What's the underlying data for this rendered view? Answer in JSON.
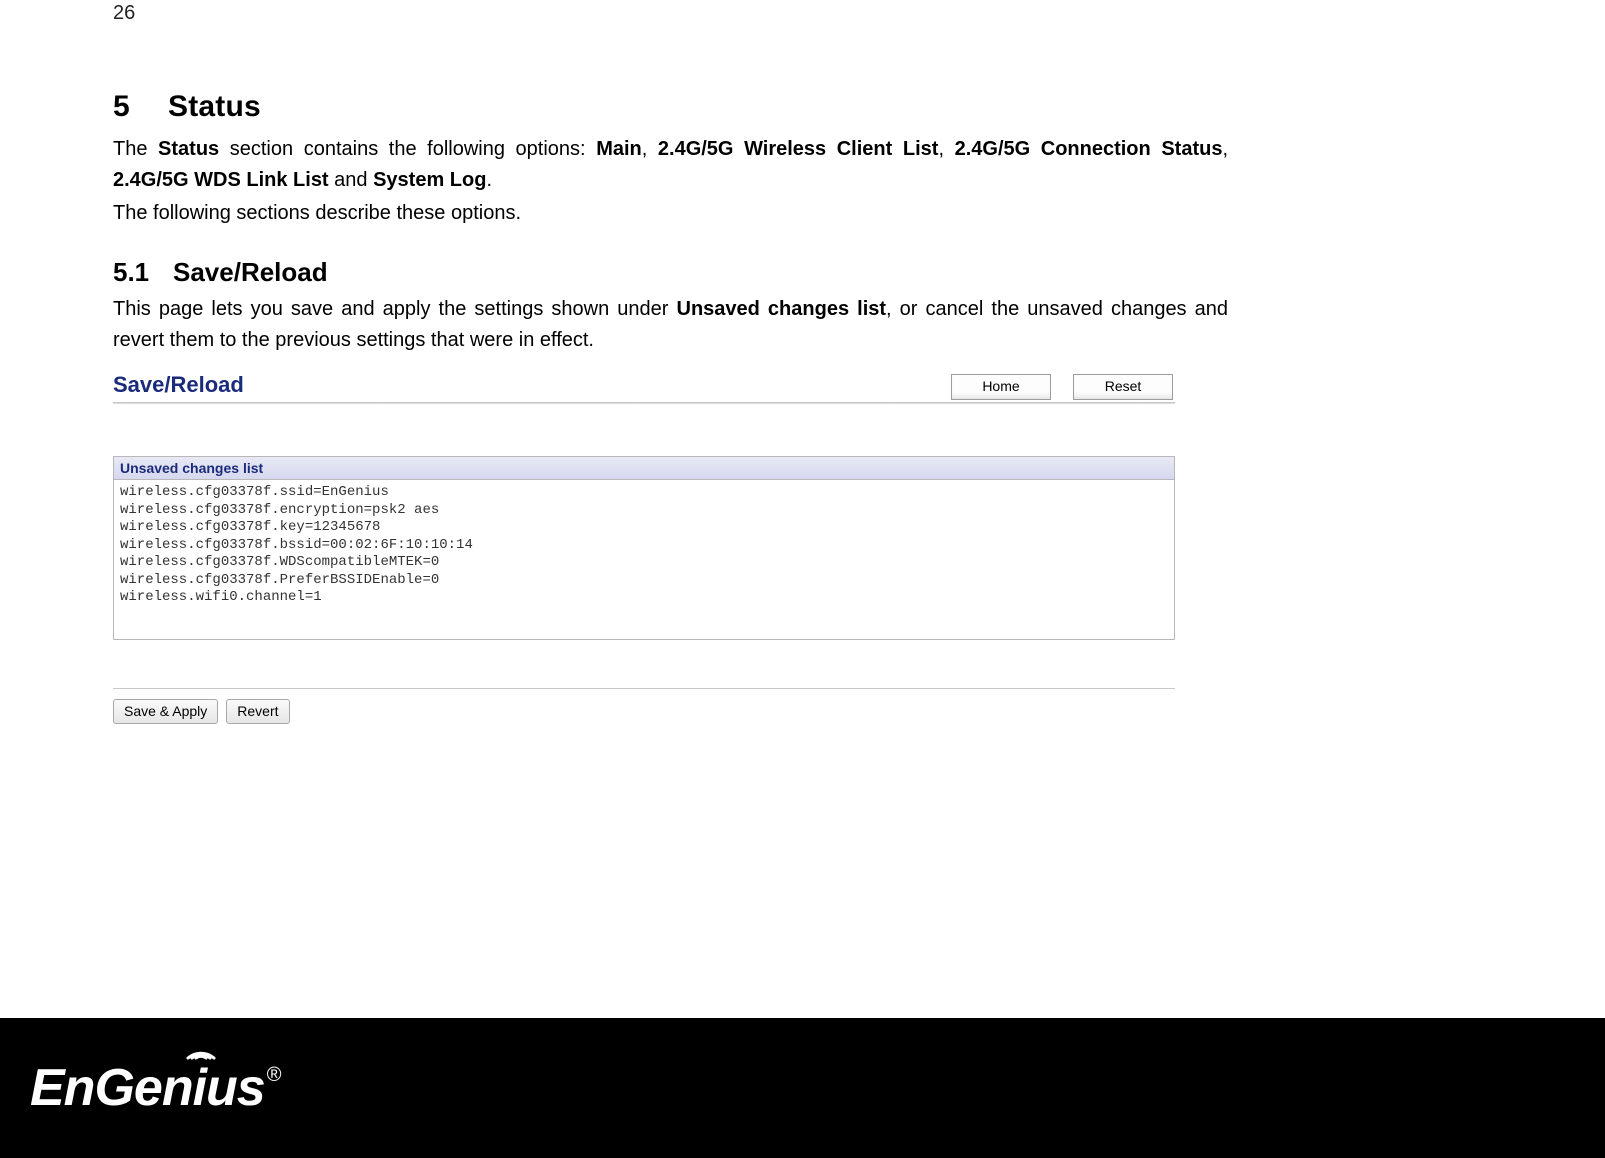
{
  "page_number": "26",
  "heading": {
    "num": "5",
    "title": "Status"
  },
  "intro": {
    "pre": "The ",
    "b1": "Status",
    "t1": " section contains the following options: ",
    "b2": "Main",
    "c1": ", ",
    "b3": "2.4G/5G Wireless Client List",
    "c2": ", ",
    "b4": "2.4G/5G Connection Status",
    "c3": ", ",
    "b5": "2.4G/5G WDS Link List",
    "t2": " and ",
    "b6": "System Log",
    "t3": "."
  },
  "intro2": "The following sections describe these options.",
  "sub": {
    "num": "5.1",
    "title": "Save/Reload"
  },
  "subtext": {
    "t1": "This page lets you save and apply the settings shown under ",
    "b1": "Unsaved changes list",
    "t2": ", or cancel the unsaved changes and revert them to the previous settings that were in effect."
  },
  "ui": {
    "title": "Save/Reload",
    "home": "Home",
    "reset": "Reset",
    "panel_header": "Unsaved changes list",
    "changes": "wireless.cfg03378f.ssid=EnGenius\nwireless.cfg03378f.encryption=psk2 aes\nwireless.cfg03378f.key=12345678\nwireless.cfg03378f.bssid=00:02:6F:10:10:14\nwireless.cfg03378f.WDScompatibleMTEK=0\nwireless.cfg03378f.PreferBSSIDEnable=0\nwireless.wifi0.channel=1",
    "save_apply": "Save & Apply",
    "revert": "Revert"
  },
  "logo": {
    "p1": "EnGen",
    "p2": "i",
    "p3": "us",
    "reg": "®"
  }
}
